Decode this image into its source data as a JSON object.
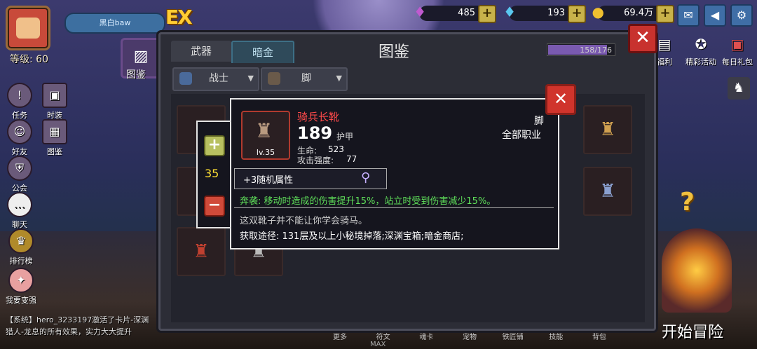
{
  "player": {
    "name": "黑白baw",
    "level": "等级: 60"
  },
  "currency": {
    "gems": "485",
    "diamonds": "193",
    "gold": "69.4万"
  },
  "left_menu": [
    {
      "label": "任务",
      "icon": "quest-icon"
    },
    {
      "label": "时装",
      "icon": "costume-icon"
    },
    {
      "label": "好友",
      "icon": "friends-icon"
    },
    {
      "label": "图鉴",
      "icon": "codex-icon"
    },
    {
      "label": "公会",
      "icon": "guild-icon"
    },
    {
      "label": "聊天",
      "icon": "chat-icon"
    },
    {
      "label": "排行榜",
      "icon": "ranking-icon"
    },
    {
      "label": "我要变强",
      "icon": "powerup-icon"
    }
  ],
  "codex_button": "图鉴",
  "right_menu": [
    {
      "label": "福利"
    },
    {
      "label": "精彩活动"
    },
    {
      "label": "每日礼包"
    }
  ],
  "panel": {
    "title": "图鉴",
    "tabs": [
      "武器",
      "暗金"
    ],
    "count": "158/176",
    "filter_class": "战士",
    "filter_slot": "脚"
  },
  "tooltip": {
    "name": "骑兵长靴",
    "item_level": "lv.35",
    "armor_value": "189",
    "armor_label": "护甲",
    "stat1_label": "生命:",
    "stat1_value": "523",
    "stat2_label": "攻击强度:",
    "stat2_value": "77",
    "slot": "脚",
    "class": "全部职业",
    "random_attr": "+3随机属性",
    "effect": "奔袭: 移动时造成的伤害提升15%，站立时受到伤害减少15%。",
    "flavor": "这双靴子并不能让你学会骑马。",
    "source": "获取途径: 131层及以上小秘境掉落;深渊宝箱;暗金商店;",
    "quantity": "35"
  },
  "chat": "【系统】hero_3233197激活了卡片-深渊猎人-龙息的所有效果，实力大大提升",
  "bottom_menu": [
    "更多",
    "符文",
    "魂卡",
    "宠物",
    "铁匠铺",
    "技能",
    "背包"
  ],
  "max_label": "MAX",
  "start_button": "开始冒险",
  "colors": {
    "accent_red": "#d0342c",
    "item_name": "#ff4a4a",
    "effect_green": "#5fe05a",
    "quantity_yellow": "#ffe033"
  }
}
